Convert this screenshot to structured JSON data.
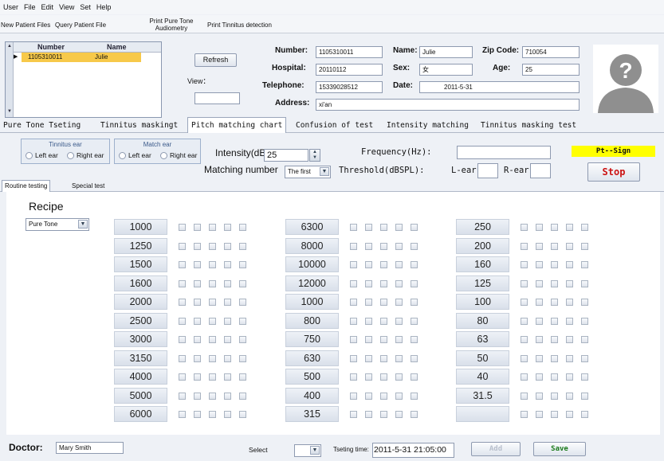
{
  "menu": [
    "User",
    "File",
    "Edit",
    "View",
    "Set",
    "Help"
  ],
  "toolbar": {
    "new_patient": "New Patient Files",
    "query_patient": "Query Patient File",
    "print_pure_tone_1": "Print Pure Tone",
    "print_pure_tone_2": "Audiometry",
    "print_tinnitus": "Print Tinnitus detection"
  },
  "patient_list": {
    "headers": [
      "Number",
      "Name"
    ],
    "rows": [
      {
        "number": "1105310011",
        "name": "Julie"
      }
    ]
  },
  "refresh_label": "Refresh",
  "view_label": "View：",
  "patient": {
    "number_label": "Number:",
    "number": "1105310011",
    "name_label": "Name:",
    "name": "Julie",
    "zip_label": "Zip Code:",
    "zip": "710054",
    "hospital_label": "Hospital:",
    "hospital": "20110112",
    "sex_label": "Sex:",
    "sex": "女",
    "age_label": "Age:",
    "age": "25",
    "telephone_label": "Telephone:",
    "telephone": "15339028512",
    "date_label": "Date:",
    "date": "2011-5-31",
    "address_label": "Address:",
    "address": "xi'an"
  },
  "tabs": [
    "Pure Tone Tseting",
    "Tinnitus maskingt",
    "Pitch matching chart",
    "Confusion of test",
    "Intensity matching",
    "Tinnitus masking  test"
  ],
  "active_tab": "Pitch matching chart",
  "controls": {
    "tinnitus_ear_title": "Tinnitus ear",
    "match_ear_title": "Match ear",
    "left_ear": "Left ear",
    "right_ear": "Right ear",
    "intensity_label": "Intensity(dBHL)",
    "intensity_value": "25",
    "matching_label": "Matching number",
    "matching_value": "The first",
    "frequency_label": "Frequency(Hz):",
    "threshold_label": "Threshold(dBSPL):",
    "lear_label": "L-ear",
    "rear_label": "R-ear",
    "pt_sign": "Pt--Sign",
    "stop_label": "Stop"
  },
  "subtabs": [
    "Routine testing",
    "Special test"
  ],
  "recipe": {
    "label": "Recipe",
    "value": "Pure Tone"
  },
  "frequencies": {
    "col1": [
      "1000",
      "1250",
      "1500",
      "1600",
      "2000",
      "2500",
      "3000",
      "3150",
      "4000",
      "5000",
      "6000"
    ],
    "col2": [
      "6300",
      "8000",
      "10000",
      "12000",
      "1000",
      "800",
      "750",
      "630",
      "500",
      "400",
      "315"
    ],
    "col3": [
      "250",
      "200",
      "160",
      "125",
      "100",
      "80",
      "63",
      "50",
      "40",
      "31.5",
      ""
    ]
  },
  "footer": {
    "doctor_label": "Doctor:",
    "doctor_name": "Mary Smith",
    "select_label": "Select",
    "testing_time_label": "Tseting time:",
    "testing_time": "2011-5-31 21:05:00",
    "add_label": "Add",
    "save_label": "Save"
  },
  "colors": {
    "accent_red": "#cc1111",
    "sign_yellow": "#ffff00",
    "selected_row": "#f7c94a"
  }
}
